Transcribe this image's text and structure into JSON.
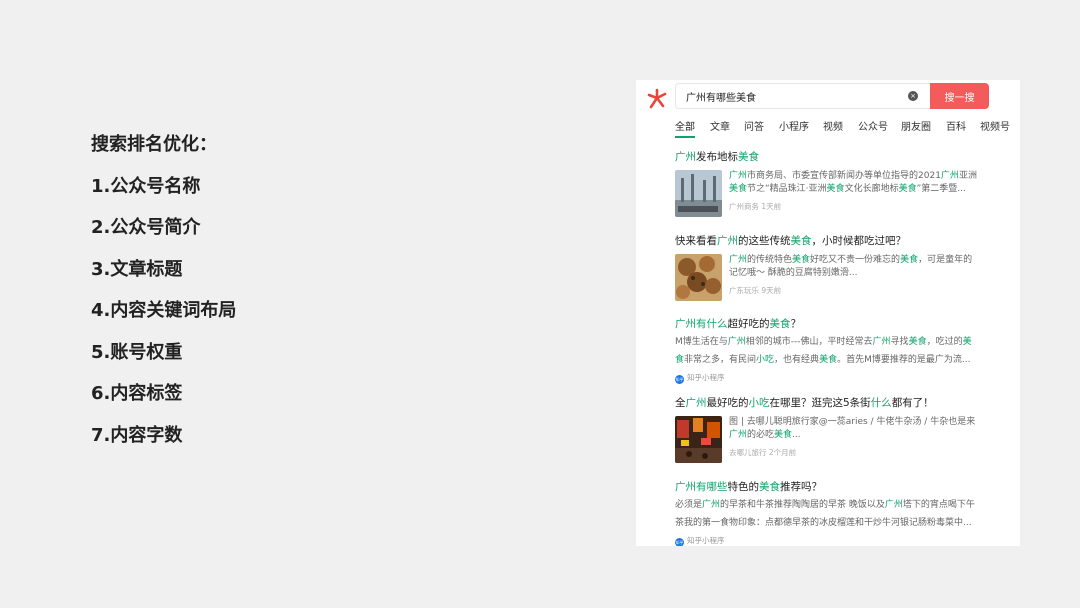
{
  "left": {
    "title": "搜索排名优化：",
    "items": [
      "1.公众号名称",
      "2.公众号简介",
      "3.文章标题",
      "4.内容关键词布局",
      "5.账号权重",
      "6.内容标签",
      "7.内容字数"
    ]
  },
  "search": {
    "query": "广州有哪些美食",
    "button": "搜一搜",
    "clear_icon": "×"
  },
  "tabs": [
    "全部",
    "文章",
    "问答",
    "小程序",
    "视频",
    "公众号",
    "朋友圈",
    "百科",
    "视频号"
  ],
  "results": [
    {
      "title_parts": [
        [
          "广州",
          1
        ],
        [
          "发布地标",
          0
        ],
        [
          "美食",
          1
        ]
      ],
      "snippet_lines": [
        [
          [
            "广州",
            1
          ],
          [
            "市商务局、市委宣传部新闻办等单位指导的2021",
            0
          ],
          [
            "广州",
            1
          ],
          [
            "亚洲",
            0
          ]
        ],
        [
          [
            "美食",
            1
          ],
          [
            "节之“精品珠江·亚洲",
            0
          ],
          [
            "美食",
            1
          ],
          [
            "文化长廊地标",
            0
          ],
          [
            "美食",
            1
          ],
          [
            "”第二季暨...",
            0
          ]
        ]
      ],
      "meta": "广州商务  1天前"
    },
    {
      "title_parts": [
        [
          "快来看看",
          0
        ],
        [
          "广州",
          1
        ],
        [
          "的这些传统",
          0
        ],
        [
          "美食",
          1
        ],
        [
          "，小时候都吃过吧？",
          0
        ]
      ],
      "snippet_lines": [
        [
          [
            "广州",
            1
          ],
          [
            "的传统特色",
            0
          ],
          [
            "美食",
            1
          ],
          [
            "好吃又不贵一份难忘的",
            0
          ],
          [
            "美食",
            1
          ],
          [
            "，可是童年的",
            0
          ]
        ],
        [
          [
            "记忆哦～ 酥脆的豆腐特别嫩滑...",
            0
          ]
        ]
      ],
      "meta": "广东玩乐  9天前"
    },
    {
      "title_parts": [
        [
          "广州",
          1
        ],
        [
          "有什么",
          1
        ],
        [
          "超好吃的",
          0
        ],
        [
          "美食",
          1
        ],
        [
          "？",
          0
        ]
      ],
      "snippet_lines": [
        [
          [
            "M博生活在与",
            0
          ],
          [
            "广州",
            1
          ],
          [
            "相邻的城市---佛山，平时经常去",
            0
          ],
          [
            "广州",
            1
          ],
          [
            "寻找",
            0
          ],
          [
            "美食",
            1
          ],
          [
            "，吃过的",
            0
          ],
          [
            "美",
            1
          ]
        ],
        [
          [
            "食",
            1
          ],
          [
            "非常之多，有民间",
            0
          ],
          [
            "小吃",
            1
          ],
          [
            "，也有经典",
            0
          ],
          [
            "美食",
            1
          ],
          [
            "。首先M博要推荐的是最广为流...",
            0
          ]
        ]
      ],
      "source": "知乎小程序",
      "source_icon": "知乎"
    },
    {
      "title_parts": [
        [
          "全",
          0
        ],
        [
          "广州",
          1
        ],
        [
          "最好吃的",
          0
        ],
        [
          "小吃",
          1
        ],
        [
          "在哪里？逛完这5条街",
          0
        ],
        [
          "什么",
          1
        ],
        [
          "都有了！",
          0
        ]
      ],
      "snippet_lines": [
        [
          [
            "图 | 去哪儿聪明旅行家@一蕊aries / 牛佬牛杂汤 / 牛杂也是来",
            0
          ]
        ],
        [
          [
            "广州",
            1
          ],
          [
            "的必吃",
            0
          ],
          [
            "美食",
            1
          ],
          [
            "...",
            0
          ]
        ]
      ],
      "meta": "去哪儿旅行  2个月前"
    },
    {
      "title_parts": [
        [
          "广州",
          1
        ],
        [
          "有哪些",
          1
        ],
        [
          "特色的",
          0
        ],
        [
          "美食",
          1
        ],
        [
          "推荐吗？",
          0
        ]
      ],
      "snippet_lines": [
        [
          [
            "必须是",
            0
          ],
          [
            "广州",
            1
          ],
          [
            "的早茶和牛茶推荐陶陶居的早茶 晚饭以及",
            0
          ],
          [
            "广州",
            1
          ],
          [
            "塔下的宵点喝下午",
            0
          ]
        ],
        [
          [
            "茶我的第一食物印象：点都德早茶的冰皮榴莲和干炒牛河银记肠粉毒菜中...",
            0
          ]
        ]
      ],
      "source": "知乎小程序",
      "source_icon": "知乎"
    }
  ],
  "colors": {
    "highlight": "#0fa36b",
    "search_button": "#f45c5c",
    "logo": "#e8453c"
  }
}
